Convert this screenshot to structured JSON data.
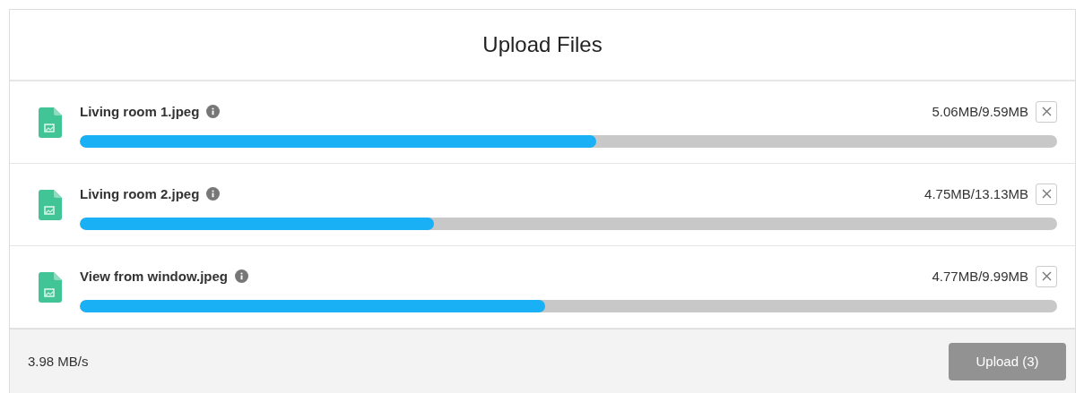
{
  "dialog": {
    "title": "Upload Files"
  },
  "files": [
    {
      "name": "Living room 1.jpeg",
      "progress": "5.06MB/9.59MB",
      "level": 0.528
    },
    {
      "name": "Living room 2.jpeg",
      "progress": "4.75MB/13.13MB",
      "level": 0.362
    },
    {
      "name": "View from window.jpeg",
      "progress": "4.77MB/9.99MB",
      "level": 0.476
    }
  ],
  "footer": {
    "speed": "3.98 MB/s",
    "upload_button": {
      "label": "Upload (3)",
      "disabled": true
    }
  }
}
